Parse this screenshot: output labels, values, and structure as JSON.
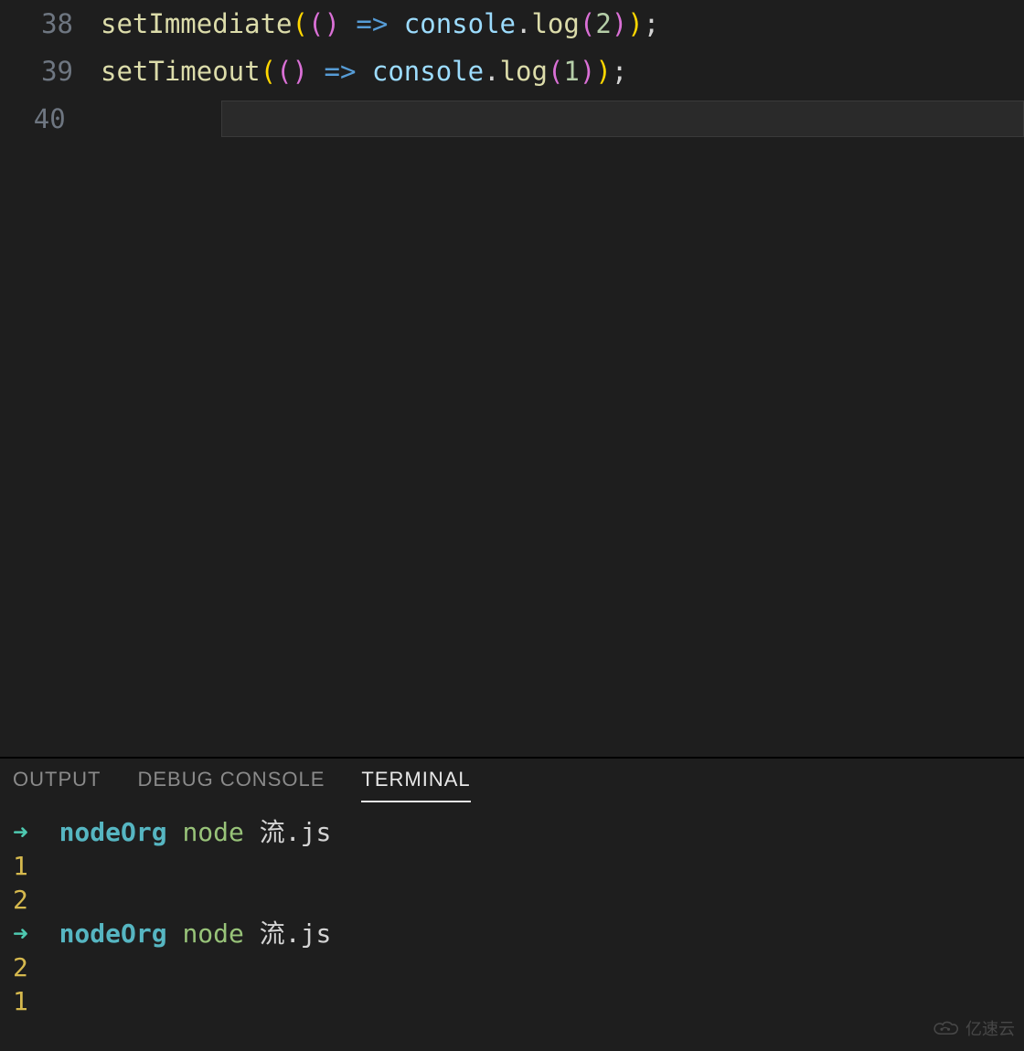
{
  "editor": {
    "lines": [
      {
        "number": "38",
        "tokens": [
          {
            "t": "setImmediate",
            "c": "tok-fn"
          },
          {
            "t": "(",
            "c": "tok-paren"
          },
          {
            "t": "(",
            "c": "tok-paren2"
          },
          {
            "t": ")",
            "c": "tok-paren2"
          },
          {
            "t": " ",
            "c": ""
          },
          {
            "t": "=>",
            "c": "tok-arrow"
          },
          {
            "t": " ",
            "c": ""
          },
          {
            "t": "console",
            "c": "tok-obj"
          },
          {
            "t": ".",
            "c": "tok-dot"
          },
          {
            "t": "log",
            "c": "tok-method"
          },
          {
            "t": "(",
            "c": "tok-paren2"
          },
          {
            "t": "2",
            "c": "tok-num"
          },
          {
            "t": ")",
            "c": "tok-paren2"
          },
          {
            "t": ")",
            "c": "tok-paren"
          },
          {
            "t": ";",
            "c": "tok-semi"
          }
        ]
      },
      {
        "number": "39",
        "tokens": [
          {
            "t": "setTimeout",
            "c": "tok-fn"
          },
          {
            "t": "(",
            "c": "tok-paren"
          },
          {
            "t": "(",
            "c": "tok-paren2"
          },
          {
            "t": ")",
            "c": "tok-paren2"
          },
          {
            "t": " ",
            "c": ""
          },
          {
            "t": "=>",
            "c": "tok-arrow"
          },
          {
            "t": " ",
            "c": ""
          },
          {
            "t": "console",
            "c": "tok-obj"
          },
          {
            "t": ".",
            "c": "tok-dot"
          },
          {
            "t": "log",
            "c": "tok-method"
          },
          {
            "t": "(",
            "c": "tok-paren2"
          },
          {
            "t": "1",
            "c": "tok-num"
          },
          {
            "t": ")",
            "c": "tok-paren2"
          },
          {
            "t": ")",
            "c": "tok-paren"
          },
          {
            "t": ";",
            "c": "tok-semi"
          }
        ]
      },
      {
        "number": "40",
        "tokens": [],
        "current": true
      }
    ]
  },
  "panel": {
    "tabs": [
      {
        "label": "OUTPUT",
        "active": false
      },
      {
        "label": "DEBUG CONSOLE",
        "active": false
      },
      {
        "label": "TERMINAL",
        "active": true
      }
    ]
  },
  "terminal": {
    "lines": [
      {
        "type": "prompt",
        "arrow": "➜",
        "context": "nodeOrg",
        "command": "node",
        "arg": "流.js"
      },
      {
        "type": "output",
        "text": "1"
      },
      {
        "type": "output",
        "text": "2"
      },
      {
        "type": "prompt",
        "arrow": "➜",
        "context": "nodeOrg",
        "command": "node",
        "arg": "流.js"
      },
      {
        "type": "output",
        "text": "2"
      },
      {
        "type": "output",
        "text": "1"
      }
    ]
  },
  "watermark": {
    "text": "亿速云"
  }
}
